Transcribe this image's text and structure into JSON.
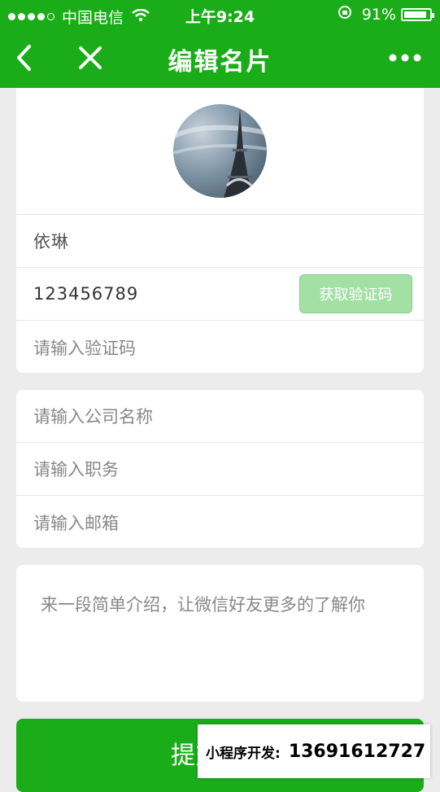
{
  "status_bar": {
    "carrier": "中国电信",
    "time": "上午9:24",
    "battery_percent": "91%",
    "battery_level": 0.91
  },
  "nav": {
    "title": "编辑名片"
  },
  "profile": {
    "name": "依琳",
    "phone": "123456789",
    "get_code_label": "获取验证码",
    "code_placeholder": "请输入验证码"
  },
  "work": {
    "company_placeholder": "请输入公司名称",
    "position_placeholder": "请输入职务",
    "email_placeholder": "请输入邮箱"
  },
  "intro": {
    "placeholder": "来一段简单介绍，让微信好友更多的了解你"
  },
  "submit_label": "提交",
  "watermark": {
    "label": "小程序开发:",
    "phone": "13691612727"
  },
  "colors": {
    "brand_green": "#1aad19",
    "disabled_button": "#a3e0a4"
  }
}
